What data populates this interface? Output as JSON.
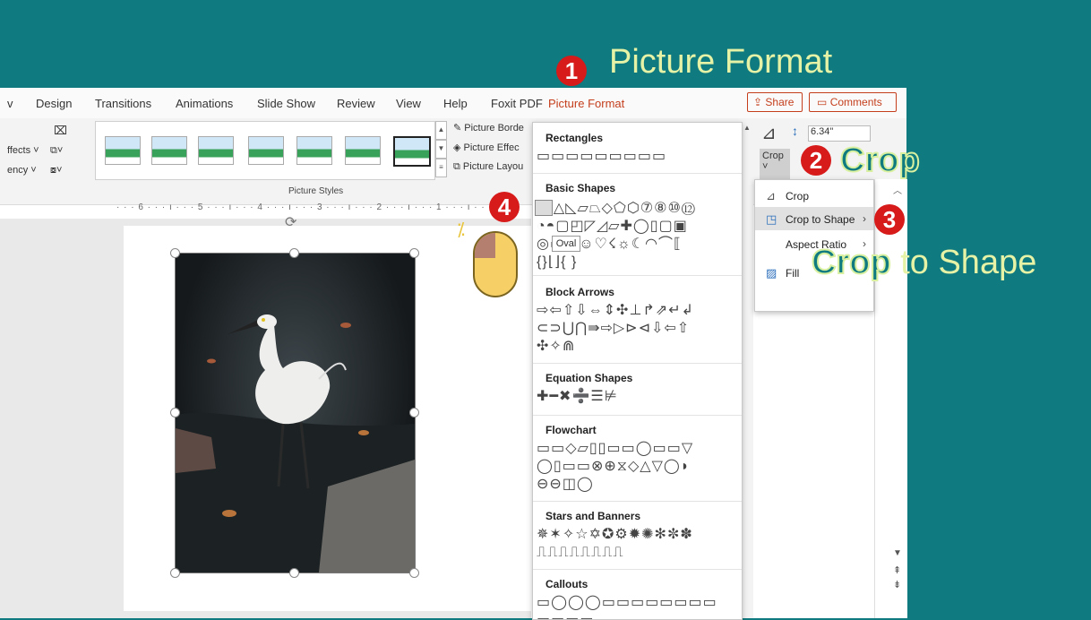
{
  "annotations": {
    "step1": {
      "num": "1",
      "text": "Picture Format"
    },
    "step2": {
      "num": "2",
      "text": "Crop"
    },
    "step3": {
      "num": "3",
      "text_crop": "Crop",
      "text_rest": " to Shape"
    },
    "step4": {
      "num": "4"
    }
  },
  "tabs": [
    "v",
    "Design",
    "Transitions",
    "Animations",
    "Slide Show",
    "Review",
    "View",
    "Help",
    "Foxit PDF",
    "Picture Format"
  ],
  "header_buttons": {
    "share": "Share",
    "comments": "Comments"
  },
  "ribbon": {
    "effects": "ffects ˅",
    "transparency": "ency ˅",
    "group_label": "Picture Styles",
    "picture_border": "Picture Borde",
    "picture_effects": "Picture Effec",
    "picture_layout": "Picture Layou",
    "size_value": "6.34\"",
    "crop_label": "Crop"
  },
  "ruler": "· · · 6 · · · ı · · · 5 · · · ı · · · 4 · · · ı · · · 3 · · · ı · · · 2 · · · ı · · · 1 · · · ı · · · 0 ·",
  "shapes_panel": {
    "sections": [
      {
        "title": "Rectangles",
        "shapes": "▭▭▭▭▭▭▭▭▭"
      },
      {
        "title": "Basic Shapes",
        "shapes": "◯△◺▱⏢◇⬠⬡⑦⑧⑩⑫\n◔◓▢◰◸◿▱✚◯▯▢▣\n◎▭▢☺♡☇☼☾◠⌒⟦\n{}⌊⌋{ }"
      },
      {
        "title": "Block Arrows",
        "shapes": "⇨⇦⇧⇩⇔⇕✣⊥↱⇗↵↲\n⊂⊃⋃⋂⇛⇨▷⊳⊲⇩⇦⇧\n✣✧⋒"
      },
      {
        "title": "Equation Shapes",
        "shapes": "✚━✖➗☰⊭"
      },
      {
        "title": "Flowchart",
        "shapes": "▭▭◇▱▯▯▭▭◯▭▭▽\n◯▯▭▭⊗⊕⧖◇△▽◯◗\n⊖⊖◫◯"
      },
      {
        "title": "Stars and Banners",
        "shapes": "✵✶✧☆✡✪⚙✹✺✻✼✽\n⎍⎍⎍⎍⎍⎍⎍⎍"
      },
      {
        "title": "Callouts",
        "shapes": "▭◯◯◯▭▭▭▭▭▭▭▭\n▭▭▭▭"
      }
    ],
    "tooltip": "Oval"
  },
  "crop_menu": {
    "items": [
      {
        "label": "Crop",
        "icon": "crop-icon"
      },
      {
        "label": "Crop to Shape",
        "icon": "crop-to-shape-icon"
      },
      {
        "label": "Aspect Ratio",
        "icon": ""
      },
      {
        "label": "Fill",
        "icon": "fill-icon"
      }
    ]
  }
}
